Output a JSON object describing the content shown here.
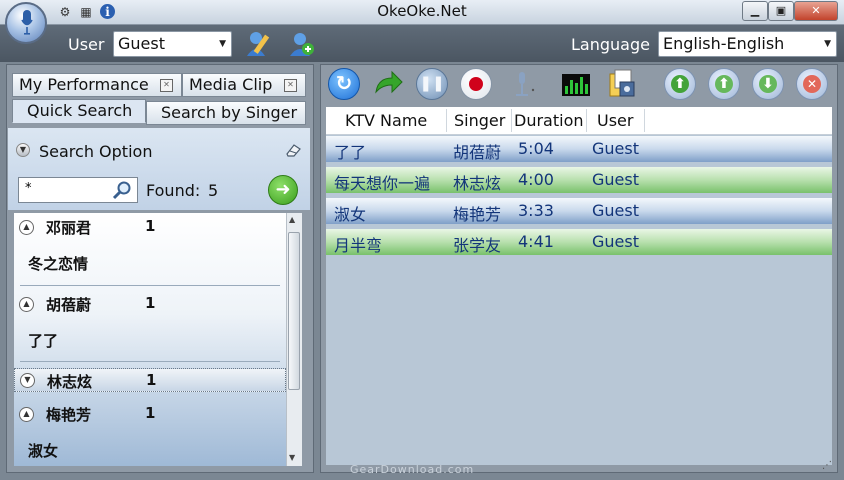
{
  "window": {
    "title": "OkeOke.Net",
    "controls": {
      "minimize": "▁",
      "restore": "▣",
      "close": "✕"
    }
  },
  "userbar": {
    "user_label": "User",
    "user_value": "Guest",
    "language_label": "Language",
    "language_value": "English-English"
  },
  "left_tabs": {
    "row1": [
      {
        "label": "My Performance"
      },
      {
        "label": "Media Clip"
      }
    ],
    "row2": [
      {
        "label": "Quick Search"
      },
      {
        "label": "Search by Singer"
      }
    ]
  },
  "search": {
    "option_label": "Search Option",
    "query": "*",
    "found_label": "Found:",
    "found_count": "5"
  },
  "results": [
    {
      "singer": "邓丽君",
      "count": "1",
      "song": "冬之恋情",
      "expanded": true
    },
    {
      "singer": "胡蓓蔚",
      "count": "1",
      "song": "了了",
      "expanded": true
    },
    {
      "singer": "林志炫",
      "count": "1",
      "song": "",
      "expanded": false
    },
    {
      "singer": "梅艳芳",
      "count": "1",
      "song": "淑女",
      "expanded": true
    }
  ],
  "toolbar_icons": [
    "refresh-icon",
    "forward-icon",
    "pause-icon",
    "record-icon",
    "microphone-icon",
    "equalizer-icon",
    "media-files-icon",
    "move-top-icon",
    "move-up-icon",
    "move-down-icon",
    "remove-icon"
  ],
  "playlist": {
    "columns": [
      "KTV Name",
      "Singer",
      "Duration",
      "User"
    ],
    "rows": [
      {
        "name": "了了",
        "singer": "胡蓓蔚",
        "duration": "5:04",
        "user": "Guest",
        "color": "blue"
      },
      {
        "name": "每天想你一遍",
        "singer": "林志炫",
        "duration": "4:00",
        "user": "Guest",
        "color": "green"
      },
      {
        "name": "淑女",
        "singer": "梅艳芳",
        "duration": "3:33",
        "user": "Guest",
        "color": "blue"
      },
      {
        "name": "月半弯",
        "singer": "张学友",
        "duration": "4:41",
        "user": "Guest",
        "color": "green"
      }
    ]
  },
  "watermark": "GearDownload.com",
  "colors": {
    "accent_green": "#3a9e1c",
    "row_blue": "#7f9fc8",
    "row_green": "#79c16b",
    "record_red": "#d0021b"
  }
}
